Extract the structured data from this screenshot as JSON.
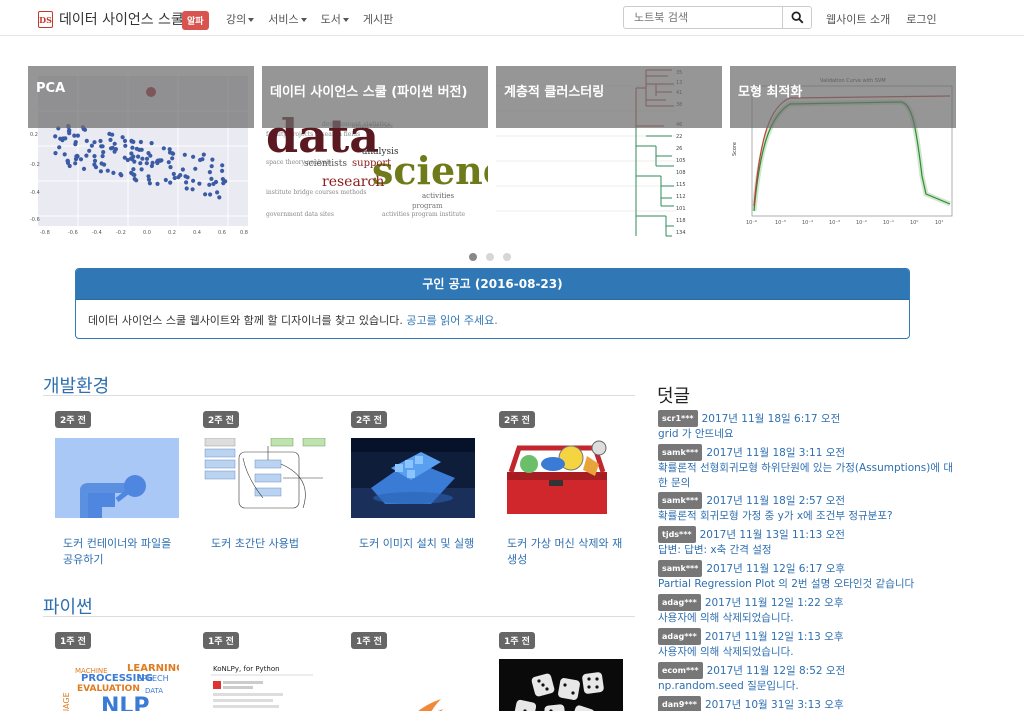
{
  "navbar": {
    "brand_logo_text": "DS",
    "brand_title": "데이터 사이언스 스쿨",
    "badge": "알파",
    "menu": [
      {
        "label": "강의",
        "dropdown": true
      },
      {
        "label": "서비스",
        "dropdown": true
      },
      {
        "label": "도서",
        "dropdown": true
      },
      {
        "label": "게시판",
        "dropdown": false
      }
    ],
    "search_placeholder": "노트북 검색",
    "right_links": [
      "웹사이트 소개",
      "로그인"
    ]
  },
  "carousel": {
    "slides": [
      {
        "caption": "PCA"
      },
      {
        "caption": "데이터 사이언스 스쿨 (파이썬 버전)"
      },
      {
        "caption": "계층적 클러스터링"
      },
      {
        "caption": "모형 최적화"
      }
    ],
    "dots": 3,
    "active_dot": 0
  },
  "notice": {
    "title": "구인 공고 (2016-08-23)",
    "body": "데이터 사이언스 스쿨 웹사이트와 함께 할 디자이너를 찾고 있습니다.",
    "link": "공고를 읽어 주세요."
  },
  "sections": [
    {
      "title": "개발환경",
      "cards": [
        {
          "time": "2주 전",
          "title": "도커 컨테이너와 파일을 공유하기"
        },
        {
          "time": "2주 전",
          "title": "도커 초간단 사용법"
        },
        {
          "time": "2주 전",
          "title": "도커 이미지 설치 및 실행"
        },
        {
          "time": "2주 전",
          "title": "도커 가상 머신 삭제와 재생성"
        }
      ]
    },
    {
      "title": "파이썬",
      "cards": [
        {
          "time": "1주 전",
          "title": ""
        },
        {
          "time": "1주 전",
          "title": ""
        },
        {
          "time": "1주 전",
          "title": ""
        },
        {
          "time": "1주 전",
          "title": ""
        }
      ]
    }
  ],
  "thumb_text": {
    "docker_diagram": "",
    "konlpy": "KoNLPy, for Python",
    "nlp_cloud": [
      "NLP",
      "PROCESSING",
      "EVALUATION",
      "LEARNING",
      "SPEECH",
      "MACHINE",
      "DATA"
    ],
    "wordcloud": [
      "data",
      "science",
      "research",
      "scientists",
      "analysis",
      "support",
      "activities",
      "program"
    ]
  },
  "comments": {
    "title": "덧글",
    "items": [
      {
        "user": "scr1***",
        "date": "2017년 11월 18일 6:17 오전",
        "text": "grid 가 안뜨네요"
      },
      {
        "user": "samk***",
        "date": "2017년 11월 18일 3:11 오전",
        "text": "확률론적 선형회귀모형 하위단원에 있는 가정(Assumptions)에 대한 문의"
      },
      {
        "user": "samk***",
        "date": "2017년 11월 18일 2:57 오전",
        "text": "확률론적 회귀모형 가정 중 y가 x에 조건부 정규분포?"
      },
      {
        "user": "tjds***",
        "date": "2017년 11월 13일 11:13 오전",
        "text": "답변: 답변: x축 간격 설정"
      },
      {
        "user": "samk***",
        "date": "2017년 11월 12일 6:17 오후",
        "text": "Partial Regression Plot 의 2번 설명 오타인것 같습니다"
      },
      {
        "user": "adag***",
        "date": "2017년 11월 12일 1:22 오후",
        "text": "사용자에 의해 삭제되었습니다."
      },
      {
        "user": "adag***",
        "date": "2017년 11월 12일 1:13 오후",
        "text": "사용자에 의해 삭제되었습니다."
      },
      {
        "user": "ecom***",
        "date": "2017년 11월 12일 8:52 오전",
        "text": "np.random.seed 질문입니다."
      },
      {
        "user": "dan9***",
        "date": "2017년 10월 31일 3:13 오후",
        "text": ""
      }
    ]
  },
  "colors": {
    "accent": "#2f6fb0",
    "badge_red": "#d9534f",
    "panel_blue": "#2f78b5"
  }
}
